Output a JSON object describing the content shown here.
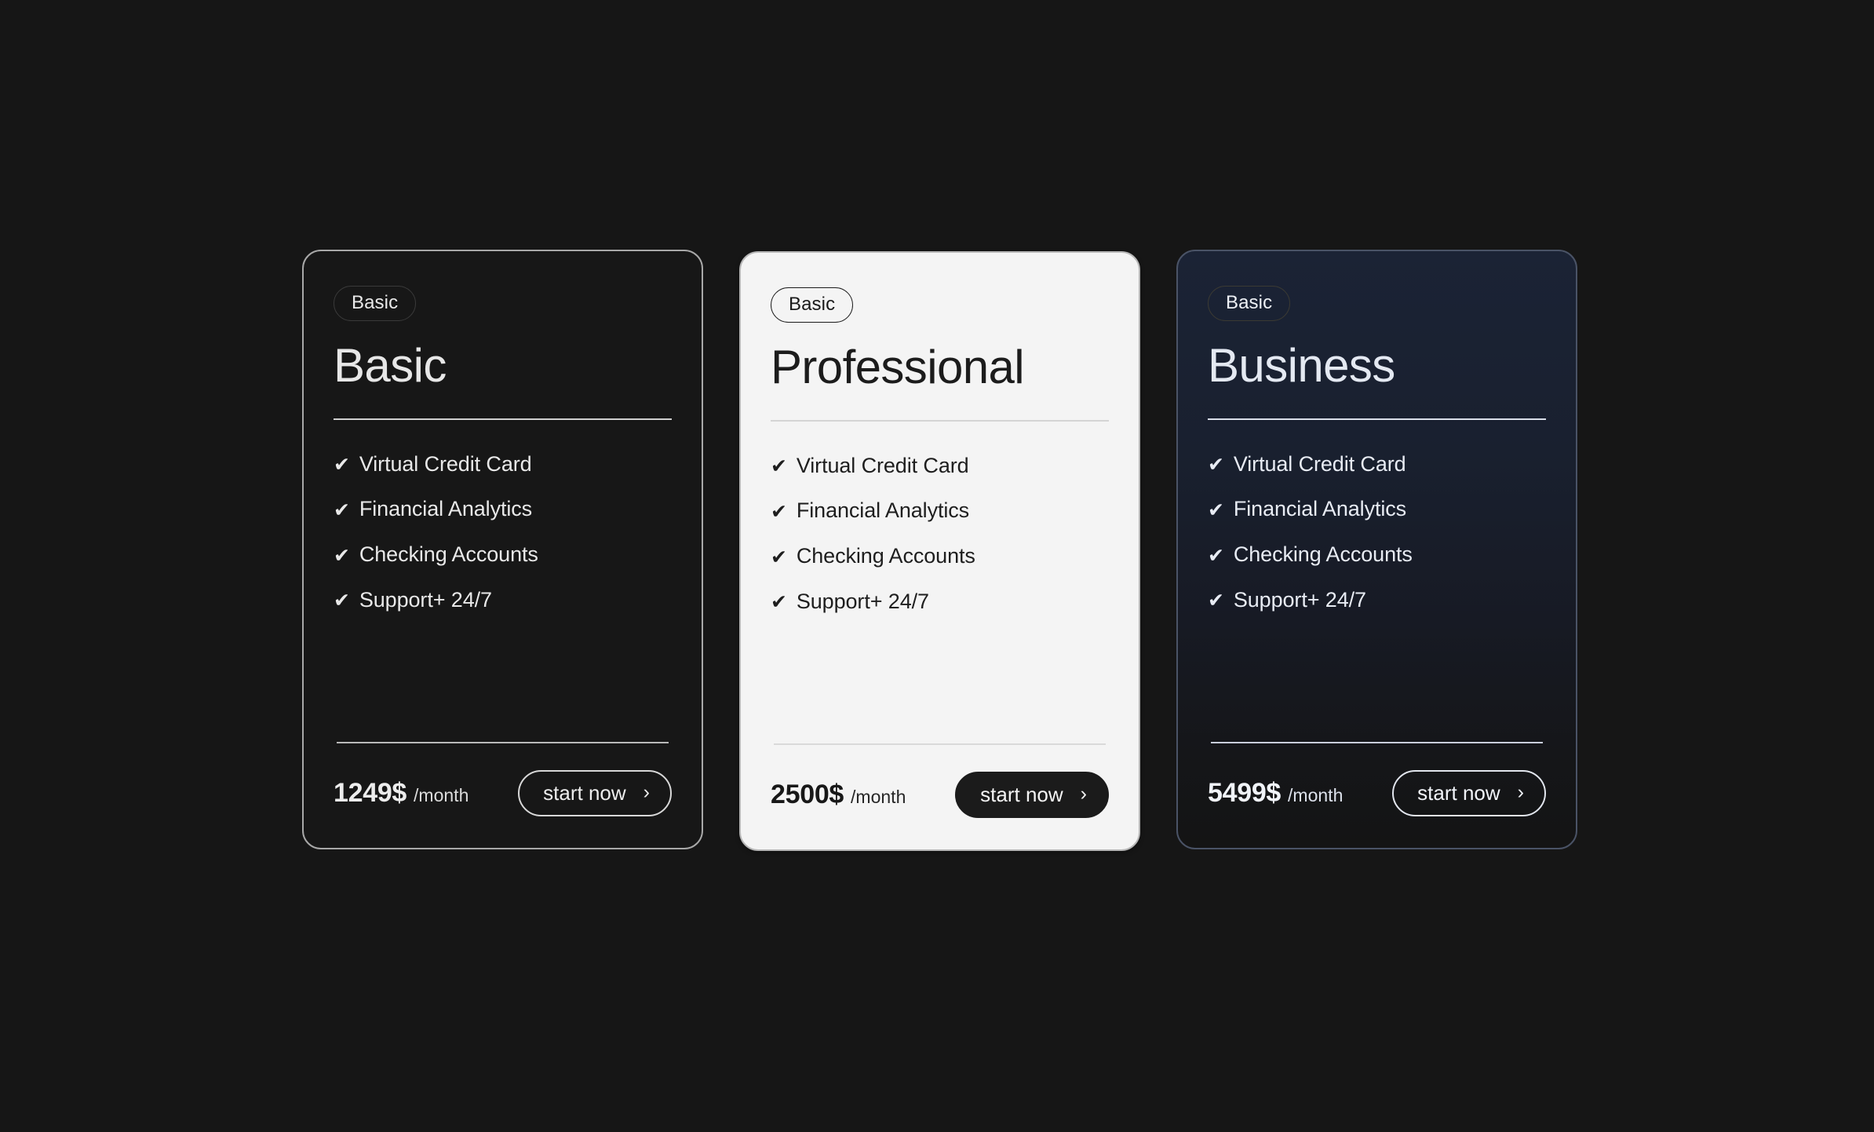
{
  "page": {
    "background_color": "#161616"
  },
  "plans": [
    {
      "badge": "Basic",
      "title": "Basic",
      "features": [
        "Virtual Credit Card",
        "Financial Analytics",
        "Checking Accounts",
        "Support+ 24/7"
      ],
      "check_icon": "✔",
      "price_amount": "1249$",
      "price_period": "/month",
      "cta_label": "start now",
      "cta_chevron": "›",
      "style": "outline",
      "card_background": "#171717",
      "border_color": "#a8a8a8",
      "text_color": "#e9e9e9"
    },
    {
      "badge": "Basic",
      "title": "Professional",
      "features": [
        "Virtual Credit Card",
        "Financial Analytics",
        "Checking Accounts",
        "Support+ 24/7"
      ],
      "check_icon": "✔",
      "price_amount": "2500$",
      "price_period": "/month",
      "cta_label": "start now",
      "cta_chevron": "›",
      "style": "light",
      "card_background": "#f4f4f4",
      "border_color": "#b6b6b6",
      "text_color": "#1c1c1c"
    },
    {
      "badge": "Basic",
      "title": "Business",
      "features": [
        "Virtual Credit Card",
        "Financial Analytics",
        "Checking Accounts",
        "Support+ 24/7"
      ],
      "check_icon": "✔",
      "price_amount": "5499$",
      "price_period": "/month",
      "cta_label": "start now",
      "cta_chevron": "›",
      "style": "navy",
      "card_background": "#1b2335",
      "border_color": "#4a5366",
      "text_color": "#e4e9f2"
    }
  ]
}
